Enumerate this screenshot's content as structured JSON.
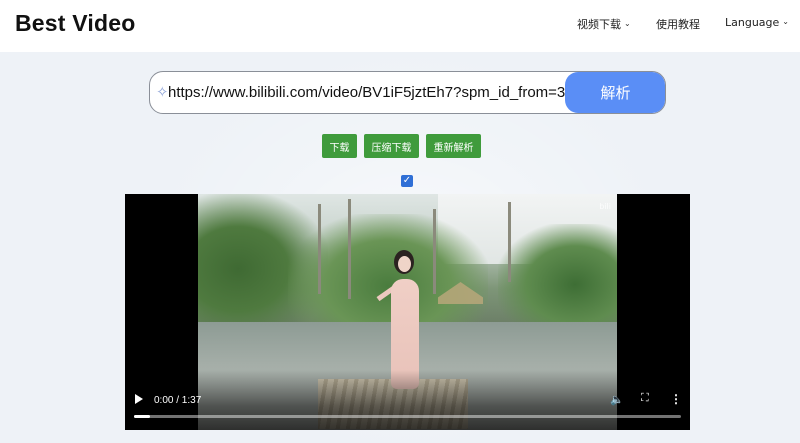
{
  "header": {
    "logo": "Best Video",
    "nav": [
      {
        "label": "视频下载",
        "has_dropdown": true
      },
      {
        "label": "使用教程",
        "has_dropdown": false
      },
      {
        "label": "Language",
        "has_dropdown": true
      }
    ]
  },
  "search": {
    "value": "https://www.bilibili.com/video/BV1iF5jztEh7?spm_id_from=3",
    "submit_label": "解析"
  },
  "actions": {
    "download_label": "下载",
    "compress_download_label": "压缩下载",
    "reparse_label": "重新解析"
  },
  "checkbox": {
    "checked": true
  },
  "player": {
    "time": "0:00 / 1:37",
    "progress": 0.03,
    "watermark": "bili"
  },
  "colors": {
    "accent": "#5a8ef6",
    "action_green": "#3f9b3c",
    "background": "#eef2f7"
  }
}
